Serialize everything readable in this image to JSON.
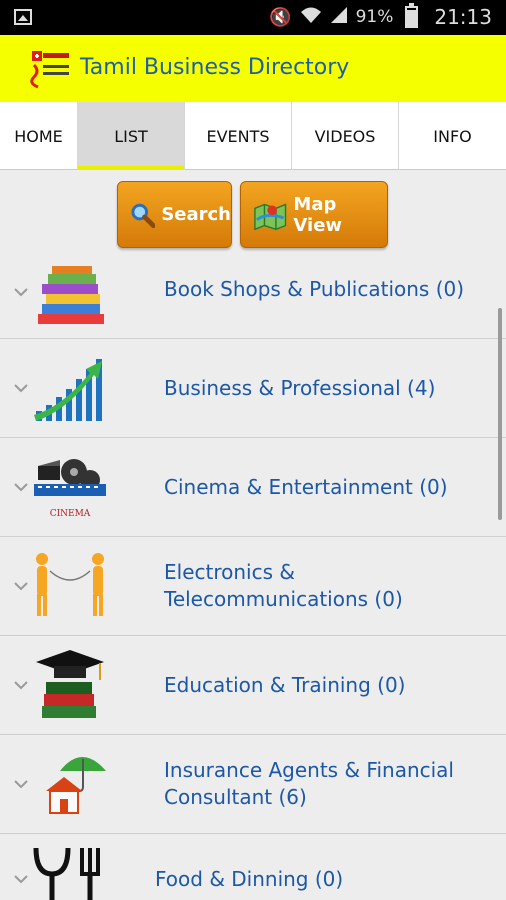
{
  "status_bar": {
    "battery_percent": "91%",
    "battery_level": 0.91,
    "time": "21:13"
  },
  "app": {
    "title": "Tamil Business Directory",
    "logo_icon": "tamil-search-directory-logo"
  },
  "tabs": [
    {
      "label": "HOME"
    },
    {
      "label": "LIST",
      "active": true
    },
    {
      "label": "EVENTS"
    },
    {
      "label": "VIDEOS"
    },
    {
      "label": "INFO"
    }
  ],
  "actions": {
    "search_label": "Search",
    "map_view_label": "Map View"
  },
  "categories": [
    {
      "label": "Book Shops & Publications (0)",
      "icon": "books-icon"
    },
    {
      "label": "Business & Professional (4)",
      "icon": "growth-chart-icon"
    },
    {
      "label": "Cinema & Entertainment (0)",
      "icon": "film-reel-icon",
      "icon_text": "CINEMA"
    },
    {
      "label": "Electronics & Telecommunications (0)",
      "icon": "tin-can-phone-icon"
    },
    {
      "label": "Education & Training (0)",
      "icon": "graduation-cap-icon"
    },
    {
      "label": "Insurance Agents & Financial Consultant (6)",
      "icon": "umbrella-house-icon"
    },
    {
      "label": "Food & Dinning (0)",
      "icon": "cutlery-icon"
    }
  ],
  "colors": {
    "app_bar": "#f5ff00",
    "title_blue": "#1f5ea8",
    "button_orange": "#e8900f",
    "label_blue": "#1c58a6"
  }
}
